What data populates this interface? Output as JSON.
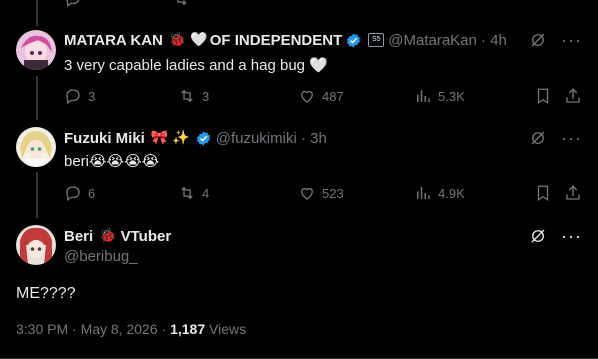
{
  "tweets": [
    {
      "name": "MATARA KAN",
      "name_emoji_1": "🐞",
      "name_emoji_2": "🤍",
      "name_suffix": "OF INDEPENDENT",
      "handle": "@MataraKan",
      "time": "4h",
      "text": "3 very capable ladies and a hag bug 🤍",
      "replies": "3",
      "reposts": "3",
      "likes": "487",
      "views": "5.3K"
    },
    {
      "name": "Fuzuki Miki",
      "name_emoji_1": "🎀",
      "name_emoji_2": "✨",
      "handle": "@fuzukimiki",
      "time": "3h",
      "text": "beri😭😭😭😭",
      "replies": "6",
      "reposts": "4",
      "likes": "523",
      "views": "4.9K"
    }
  ],
  "main": {
    "name": "Beri",
    "name_emoji": "🐞",
    "name_suffix": "VTuber",
    "handle": "@beribug_",
    "text": "ME????",
    "timestamp": "3:30 PM · May 8, 2026 · ",
    "views_count": "1,187",
    "views_label": " Views"
  },
  "colors": {
    "verified": "#1d9bf0",
    "muted": "#71767b",
    "background": "#000000"
  },
  "icons": [
    "reply-icon",
    "repost-icon",
    "like-icon",
    "views-icon",
    "bookmark-icon",
    "share-icon",
    "grok-icon",
    "more-icon",
    "verified-icon"
  ]
}
